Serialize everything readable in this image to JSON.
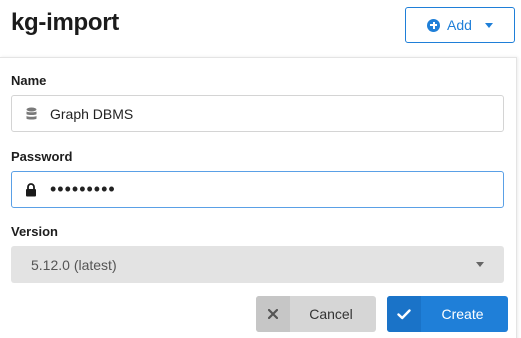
{
  "header": {
    "title": "kg-import",
    "add_button_label": "Add"
  },
  "form": {
    "name": {
      "label": "Name",
      "value": "Graph DBMS",
      "icon": "database-icon"
    },
    "password": {
      "label": "Password",
      "value": "•••••••••",
      "icon": "lock-icon"
    },
    "version": {
      "label": "Version",
      "selected": "5.12.0 (latest)"
    }
  },
  "actions": {
    "cancel_label": "Cancel",
    "create_label": "Create"
  },
  "colors": {
    "accent": "#1f7fd8",
    "focus_border": "#5aa0e6",
    "select_bg": "#e3e3e3",
    "cancel_bg": "#d6d6d6"
  }
}
